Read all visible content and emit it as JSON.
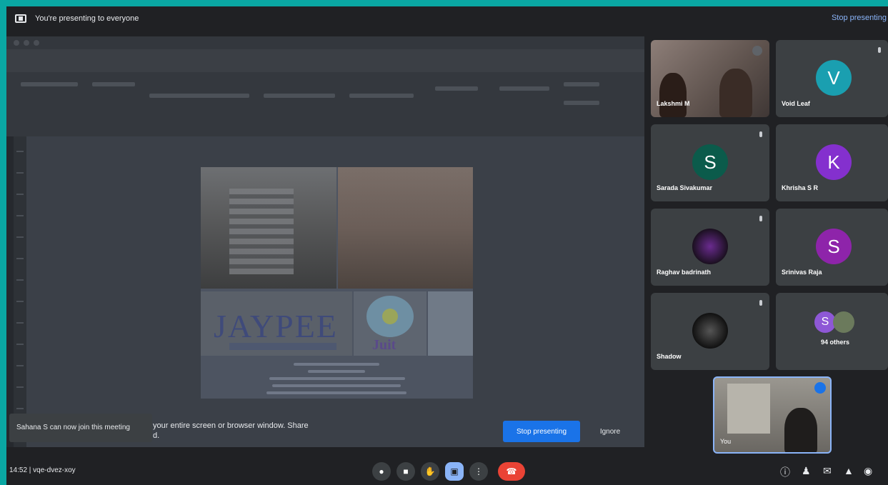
{
  "topbar": {
    "presenting_text": "You're presenting to everyone",
    "stop_link": "Stop presenting"
  },
  "share": {
    "message_line1": "your entire screen or browser window. Share",
    "message_line2": "d.",
    "toast": "Sahana S can now join this meeting",
    "stop_button": "Stop presenting",
    "ignore_button": "Ignore"
  },
  "slide": {
    "logo_text": "JAYPEE",
    "juit_text": "Juit"
  },
  "participants": [
    {
      "name": "Lakshmi M",
      "initial": "",
      "color": ""
    },
    {
      "name": "Void Leaf",
      "initial": "V",
      "color": "#1a9fb0"
    },
    {
      "name": "Sarada Sivakumar",
      "initial": "S",
      "color": "#0b5b4b"
    },
    {
      "name": "Khrisha S R",
      "initial": "K",
      "color": "#8430ce"
    },
    {
      "name": "Raghav badrinath",
      "initial": "",
      "color": ""
    },
    {
      "name": "Srinivas Raja",
      "initial": "S",
      "color": "#8e24aa"
    },
    {
      "name": "Shadow",
      "initial": "",
      "color": ""
    },
    {
      "name": "94 others",
      "initial": "S",
      "color": "#8e58d6"
    }
  ],
  "self_tile": {
    "name": "You"
  },
  "bottom": {
    "time_code": "14:52  |  vqe-dvez-xoy",
    "controls": [
      "mic",
      "camera",
      "raise-hand",
      "present",
      "more",
      "end-call"
    ]
  }
}
